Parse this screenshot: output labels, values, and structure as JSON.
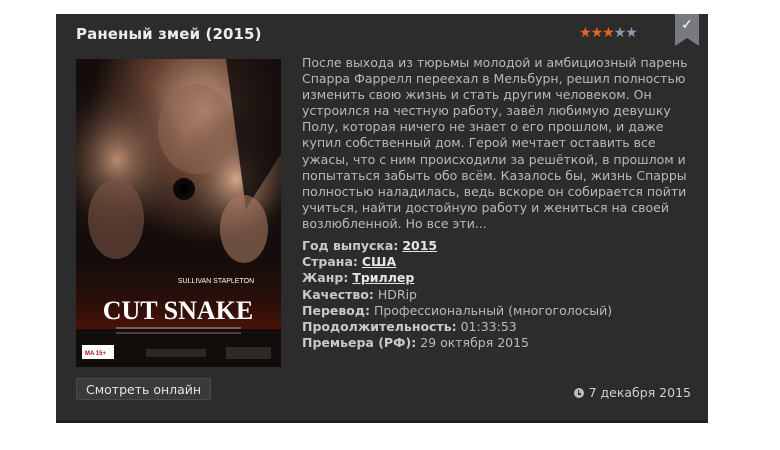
{
  "movie": {
    "title": "Раненый змей (2015)",
    "rating": 3,
    "rating_max": 5,
    "description": "После выхода из тюрьмы молодой и амбициозный парень Спарра Фаррелл переехал в Мельбурн, решил полностью изменить свою жизнь и стать другим человеком. Он устроился на честную работу, завёл любимую девушку Полу, которая ничего не знает о его прошлом, и даже купил собственный дом. Герой мечтает оставить все ужасы, что с ним происходили за решёткой, в прошлом и попытаться забыть обо всём. Казалось бы, жизнь Спарры полностью наладилась, ведь вскоре он собирается пойти учиться, найти достойную работу и жениться на своей возлюбленной. Но все эти...",
    "poster": {
      "actor": "SULLIVAN STAPLETON",
      "title": "CUT SNAKE",
      "rating_badge": "MA 15+"
    },
    "details": {
      "year_label": "Год выпуска:",
      "year": "2015",
      "country_label": "Страна:",
      "country": "США",
      "genre_label": "Жанр:",
      "genre": "Триллер",
      "quality_label": "Качество:",
      "quality": "HDRip",
      "translation_label": "Перевод:",
      "translation": "Профессиональный (многоголосый)",
      "duration_label": "Продолжительность:",
      "duration": "01:33:53",
      "premiere_label": "Премьера (РФ):",
      "premiere": "29 октября 2015"
    },
    "watch_button": "Смотреть онлайн",
    "date": "7 декабря 2015"
  },
  "icons": {
    "bookmark": "bookmark-check-icon",
    "clock": "clock-icon",
    "star": "star-icon"
  },
  "colors": {
    "card_bg": "#2c2c2c",
    "star_on": "#e9641e",
    "star_off": "#8a9ab0"
  }
}
